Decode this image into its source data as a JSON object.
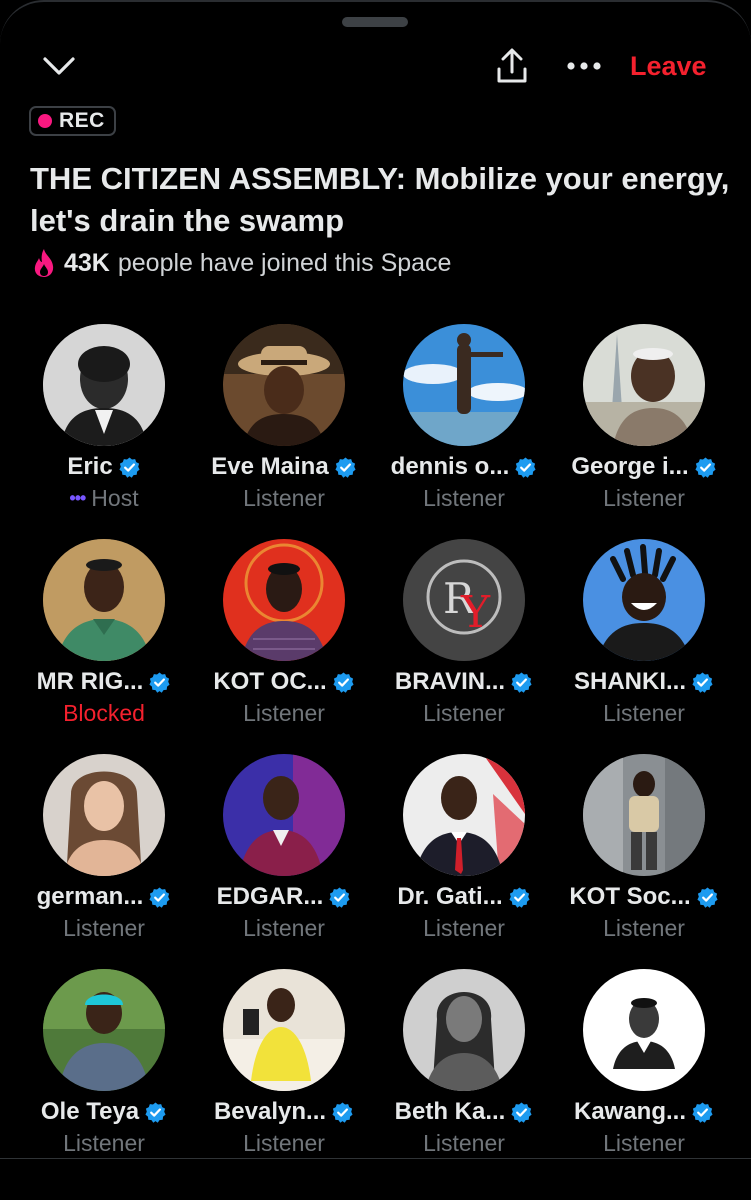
{
  "header": {
    "leave_label": "Leave",
    "rec_label": "REC"
  },
  "space": {
    "title": "THE CITIZEN ASSEMBLY: Mobilize your energy, let's drain the swamp",
    "joined_count": "43K",
    "joined_text": "people have joined this Space"
  },
  "colors": {
    "accent_red": "#f4212e",
    "rec_dot": "#f91880",
    "verified_blue": "#1d9bf0",
    "muted": "#71767b",
    "host_dots": "#7856ff"
  },
  "participants": [
    {
      "name": "Eric",
      "role": "Host",
      "verified": true,
      "avatar": "bw-portrait"
    },
    {
      "name": "Eve Maina",
      "role": "Listener",
      "verified": true,
      "avatar": "hat-portrait"
    },
    {
      "name": "dennis o...",
      "role": "Listener",
      "verified": true,
      "avatar": "sky-pose"
    },
    {
      "name": "George i...",
      "role": "Listener",
      "verified": true,
      "avatar": "city-portrait"
    },
    {
      "name": "MR RIG...",
      "role": "Blocked",
      "verified": true,
      "avatar": "green-shirt"
    },
    {
      "name": "KOT OC...",
      "role": "Listener",
      "verified": true,
      "avatar": "red-bg-portrait"
    },
    {
      "name": "BRAVIN...",
      "role": "Listener",
      "verified": true,
      "avatar": "ry-logo"
    },
    {
      "name": "SHANKI...",
      "role": "Listener",
      "verified": true,
      "avatar": "cartoon-laugh"
    },
    {
      "name": "german...",
      "role": "Listener",
      "verified": true,
      "avatar": "woman-portrait"
    },
    {
      "name": "EDGAR...",
      "role": "Listener",
      "verified": true,
      "avatar": "blazer-portrait"
    },
    {
      "name": "Dr. Gati...",
      "role": "Listener",
      "verified": true,
      "avatar": "suit-red-tie"
    },
    {
      "name": "KOT Soc...",
      "role": "Listener",
      "verified": true,
      "avatar": "standing-man"
    },
    {
      "name": "Ole Teya",
      "role": "Listener",
      "verified": true,
      "avatar": "cap-portrait"
    },
    {
      "name": "Bevalyn...",
      "role": "Listener",
      "verified": true,
      "avatar": "yellow-blazer"
    },
    {
      "name": "Beth Ka...",
      "role": "Listener",
      "verified": true,
      "avatar": "bw-woman"
    },
    {
      "name": "Kawang...",
      "role": "Listener",
      "verified": true,
      "avatar": "white-bg-man"
    }
  ]
}
